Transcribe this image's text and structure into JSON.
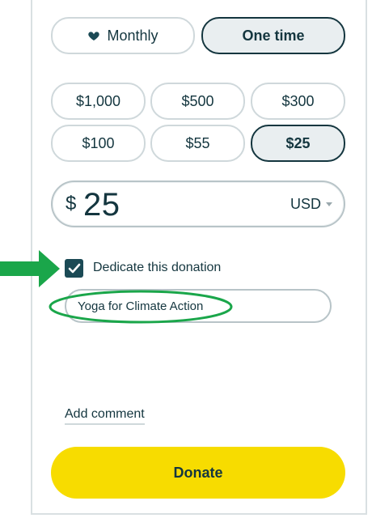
{
  "frequency": {
    "monthly_label": "Monthly",
    "one_time_label": "One time",
    "selected": "One time"
  },
  "preset_amounts": {
    "a1000": "$1,000",
    "a500": "$500",
    "a300": "$300",
    "a100": "$100",
    "a55": "$55",
    "a25": "$25",
    "selected": "$25"
  },
  "amount": {
    "symbol": "$",
    "value": "25",
    "currency": "USD"
  },
  "dedication": {
    "checked": true,
    "label": "Dedicate this donation",
    "honoree": "Yoga for Climate Action"
  },
  "comment": {
    "label": "Add comment"
  },
  "donate": {
    "label": "Donate"
  },
  "colors": {
    "accent": "#14363f",
    "donate_button": "#f7dc00",
    "annotation_green": "#1aa64a"
  }
}
